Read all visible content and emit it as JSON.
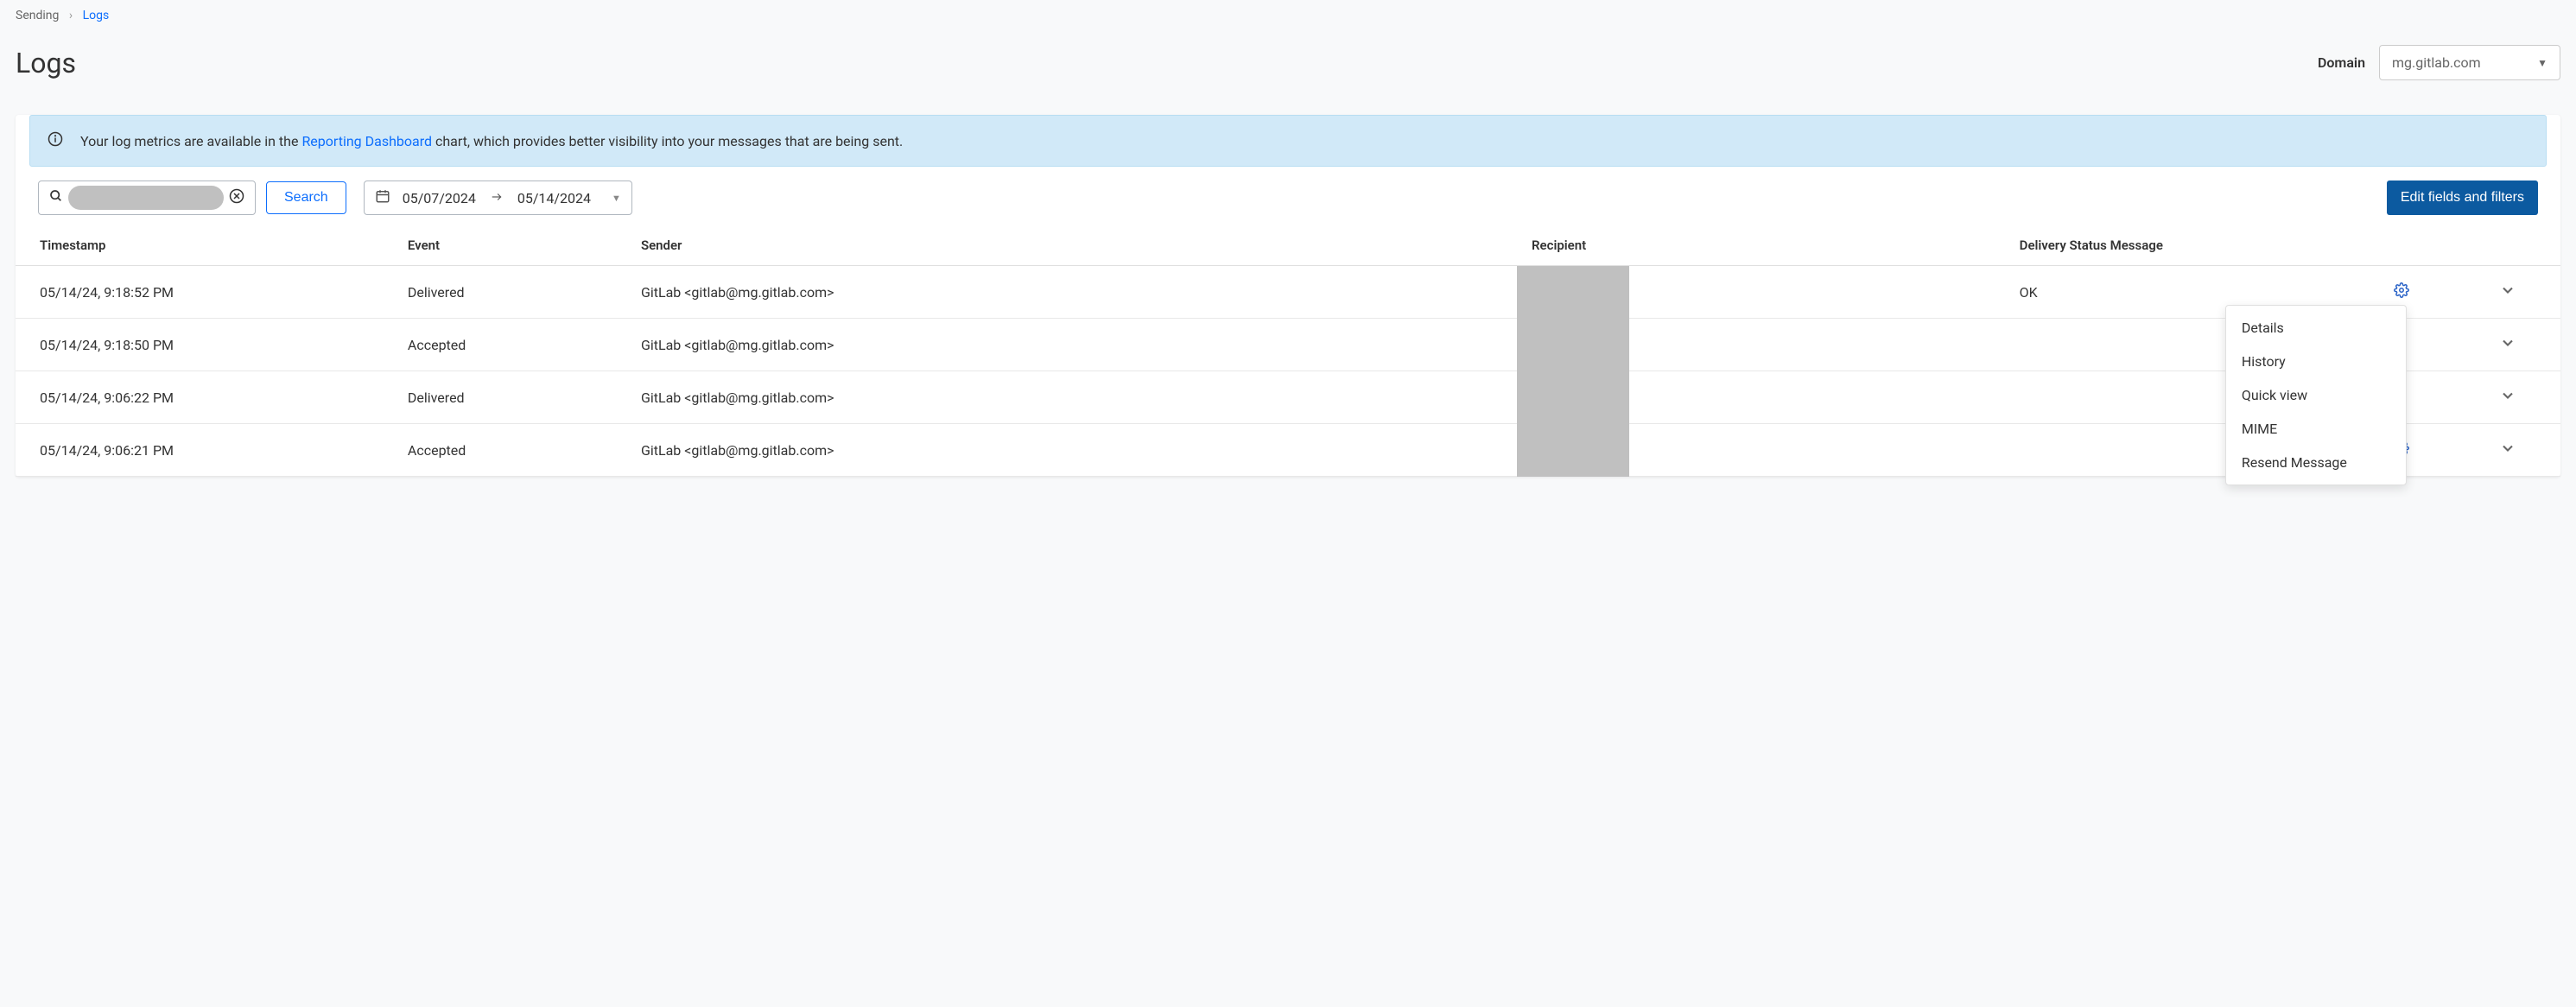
{
  "breadcrumb": {
    "parent": "Sending",
    "current": "Logs"
  },
  "page_title": "Logs",
  "domain": {
    "label": "Domain",
    "value": "mg.gitlab.com"
  },
  "info_banner": {
    "prefix": "Your log metrics are available in the ",
    "link": "Reporting Dashboard",
    "suffix": " chart, which provides better visibility into your messages that are being sent."
  },
  "filters": {
    "search_button": "Search",
    "date_from": "05/07/2024",
    "date_to": "05/14/2024",
    "edit_button": "Edit fields and filters"
  },
  "columns": {
    "timestamp": "Timestamp",
    "event": "Event",
    "sender": "Sender",
    "recipient": "Recipient",
    "delivery": "Delivery Status Message"
  },
  "rows": [
    {
      "timestamp": "05/14/24, 9:18:52 PM",
      "event": "Delivered",
      "sender": "GitLab <gitlab@mg.gitlab.com>",
      "recipient": "",
      "delivery": "OK"
    },
    {
      "timestamp": "05/14/24, 9:18:50 PM",
      "event": "Accepted",
      "sender": "GitLab <gitlab@mg.gitlab.com>",
      "recipient": "",
      "delivery": ""
    },
    {
      "timestamp": "05/14/24, 9:06:22 PM",
      "event": "Delivered",
      "sender": "GitLab <gitlab@mg.gitlab.com>",
      "recipient": "",
      "delivery": ""
    },
    {
      "timestamp": "05/14/24, 9:06:21 PM",
      "event": "Accepted",
      "sender": "GitLab <gitlab@mg.gitlab.com>",
      "recipient": "",
      "delivery": ""
    }
  ],
  "dropdown": {
    "items": [
      "Details",
      "History",
      "Quick view",
      "MIME",
      "Resend Message"
    ]
  }
}
